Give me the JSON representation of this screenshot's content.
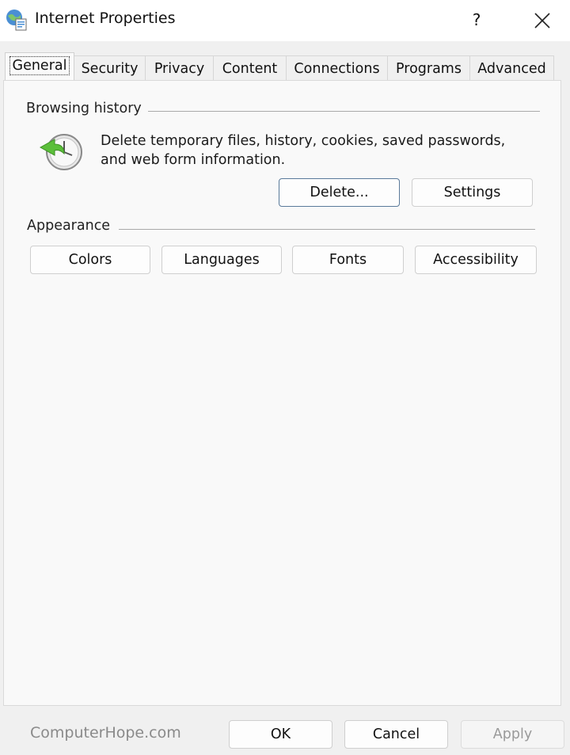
{
  "window": {
    "title": "Internet Properties",
    "help_label": "?",
    "icons": {
      "app": "internet-globe-icon",
      "close": "close-icon"
    }
  },
  "tabs": [
    {
      "label": "General",
      "active": true
    },
    {
      "label": "Security",
      "active": false
    },
    {
      "label": "Privacy",
      "active": false
    },
    {
      "label": "Content",
      "active": false
    },
    {
      "label": "Connections",
      "active": false
    },
    {
      "label": "Programs",
      "active": false
    },
    {
      "label": "Advanced",
      "active": false
    }
  ],
  "browsing_history": {
    "title": "Browsing history",
    "description": "Delete temporary files, history, cookies, saved passwords, and web form information.",
    "icon": "history-clock-icon",
    "delete_label": "Delete...",
    "settings_label": "Settings"
  },
  "appearance": {
    "title": "Appearance",
    "buttons": [
      "Colors",
      "Languages",
      "Fonts",
      "Accessibility"
    ]
  },
  "footer": {
    "brand": "ComputerHope.com",
    "ok_label": "OK",
    "cancel_label": "Cancel",
    "apply_label": "Apply",
    "apply_enabled": false
  },
  "colors": {
    "focus_border": "#5a7a9a",
    "history_arrow": "#5bbf3a"
  }
}
